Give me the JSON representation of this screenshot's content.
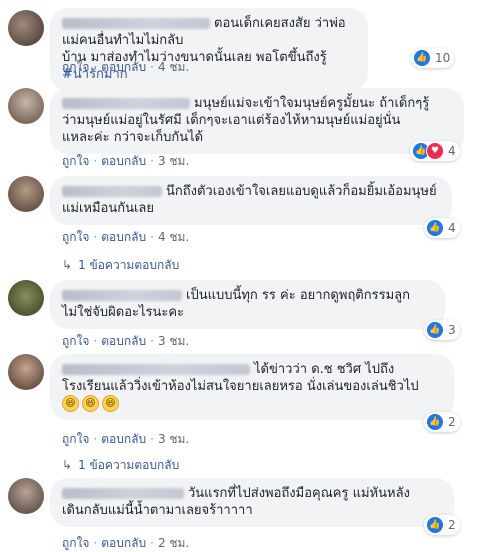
{
  "actions": {
    "like": "ถูกใจ",
    "reply": "ตอบกลับ"
  },
  "comments": [
    {
      "lines": [
        "ตอนเด็กเคยสงสัย ว่าพ่อแม่คนอื่นทำไมไม่กลับ",
        "บ้าน มาส่องทำไมว่างขนาดนั้นเลย พอโตขึ้นถึงรู้ "
      ],
      "hashtag": "#น่ารักมาก",
      "time": "4 ชม.",
      "reactions": {
        "count": "10",
        "love": false
      }
    },
    {
      "lines": [
        "มนุษย์แม่จะเข้าใจมนุษย์ครูมั้ยนะ ถ้าเด็กๆรู้",
        "ว่ามนุษย์แม่อยู่ในรัศมี เด็กๆจะเอาแต่ร้องไห้หามนุษย์แม่อยู่นั่น",
        "แหละค่ะ กว่าจะเก็บกันได้"
      ],
      "time": "3 ชม.",
      "reactions": {
        "count": "4",
        "love": true
      }
    },
    {
      "lines": [
        "นึกถึงตัวเองเข้าใจเลยแอบดูแล้วก็อมยิ้มเอ้อมนุษย์",
        "แม่เหมือนกันเลย"
      ],
      "time": "4 ชม.",
      "reactions": {
        "count": "4",
        "love": false
      },
      "reply_label": "1 ข้อความตอบกลับ"
    },
    {
      "lines": [
        "เป็นแบบนี้ทุก รร ค่ะ อยากดูพฤติกรรมลูก",
        "ไม่ใช่จับผิดอะไรนะคะ"
      ],
      "time": "3 ชม.",
      "reactions": {
        "count": "3",
        "love": false
      }
    },
    {
      "lines": [
        "ได้ข่าวว่า ด.ช ชวิศ ไปถึง",
        "โรงเรียนแล้ววิ่งเข้าห้องไม่สนใจยายเลยหรอ นั่งเล่นของเล่นชิวไป"
      ],
      "emoji_count": 3,
      "time": "3 ชม.",
      "reactions": {
        "count": "2",
        "love": false
      },
      "reply_label": "1 ข้อความตอบกลับ"
    },
    {
      "lines": [
        "วันแรกที่ไปส่งพอถึงมือคุณครู แม่หันหลัง",
        "เดินกลับแม่นี้น้ำตามาเลยจร้าาาาา"
      ],
      "time": "2 ชม.",
      "reactions": {
        "count": "2",
        "love": false
      }
    }
  ]
}
